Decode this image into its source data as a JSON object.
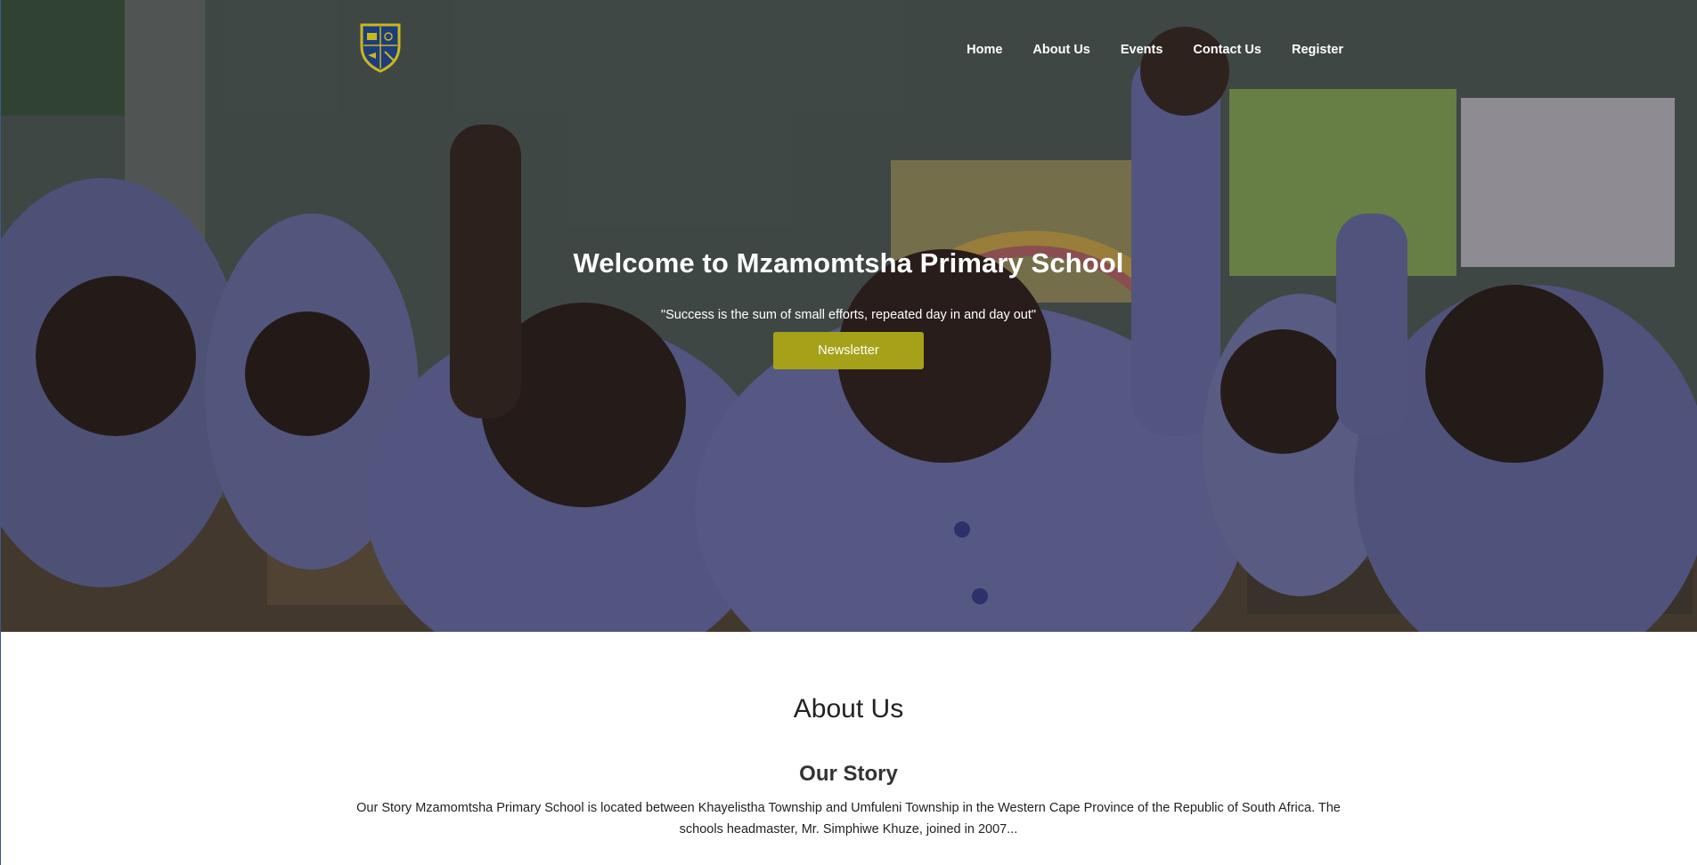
{
  "nav": {
    "links": [
      "Home",
      "About Us",
      "Events",
      "Contact Us",
      "Register"
    ]
  },
  "hero": {
    "title": "Welcome to Mzamomtsha Primary School",
    "quote": "\"Success is the sum of small efforts, repeated day in and day out\"",
    "button_label": "Newsletter"
  },
  "about": {
    "heading": "About Us",
    "story_heading": "Our Story",
    "story_text": "Our Story Mzamomtsha Primary School is located between Khayelistha Township and Umfuleni Township in the Western Cape Province of the Republic of South Africa. The schools headmaster, Mr. Simphiwe Khuze, joined in 2007..."
  },
  "colors": {
    "accent": "#a5a21a",
    "crest_blue": "#1f3d7a",
    "crest_gold": "#c9b81e"
  }
}
